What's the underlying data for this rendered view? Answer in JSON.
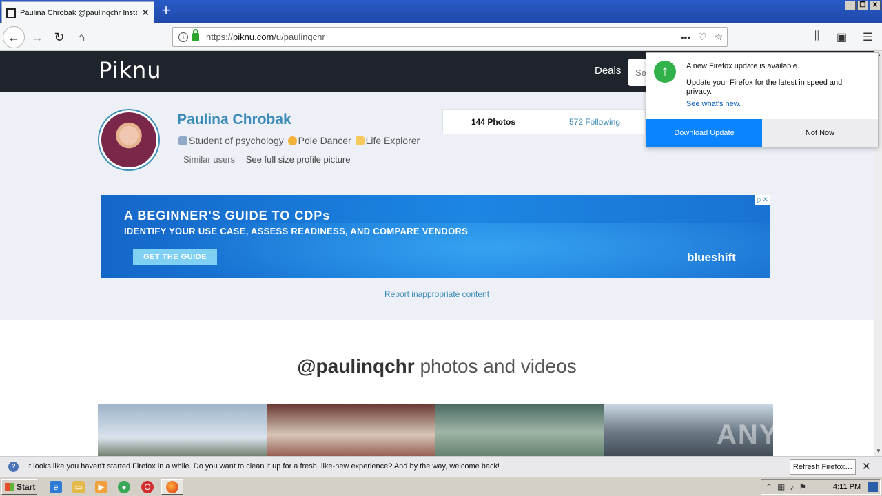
{
  "browser": {
    "tab_title": "Paulina Chrobak @paulinqchr Insta",
    "new_tab": "+",
    "url_prefix": "https://",
    "url_domain": "piknu.com",
    "url_path": "/u/paulinqchr"
  },
  "site": {
    "logo": "Piknu",
    "nav_deals": "Deals",
    "search_placeholder": "Se"
  },
  "profile": {
    "name": "Paulina Chrobak",
    "bio_part1": "Student of psychology",
    "bio_part2": "Pole Dancer",
    "bio_part3": "Life Explorer",
    "similar_users": "Similar users",
    "full_size": "See full size profile picture",
    "stats": {
      "photos": "144 Photos",
      "following": "572 Following"
    }
  },
  "ad": {
    "headline": "A BEGINNER'S GUIDE TO CDPs",
    "subhead": "IDENTIFY YOUR USE CASE, ASSESS READINESS, AND COMPARE VENDORS",
    "cta": "GET THE GUIDE",
    "brand": "blueshift",
    "close": "▷✕"
  },
  "report_link": "Report inappropriate content",
  "section": {
    "handle": "@paulinqchr",
    "rest": " photos and videos"
  },
  "watermark": "ANY RUN",
  "update_popup": {
    "title": "A new Firefox update is available.",
    "body": "Update your Firefox for the latest in speed and privacy.",
    "link": "See what's new.",
    "download": "Download Update",
    "not_now": "Not Now"
  },
  "notification": {
    "text": "It looks like you haven't started Firefox in a while. Do you want to clean it up for a fresh, like-new experience? And by the way, welcome back!",
    "button": "Refresh Firefox…"
  },
  "taskbar": {
    "start": "Start",
    "clock": "4:11 PM"
  },
  "colors": {
    "accent": "#3b8bb8",
    "header_bg": "#1f232b",
    "profile_bg": "#edf0f6",
    "update_blue": "#0a84ff"
  }
}
